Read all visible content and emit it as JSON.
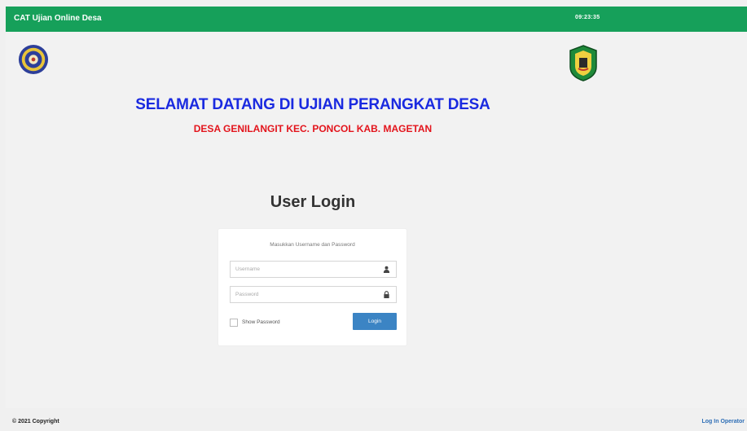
{
  "header": {
    "app_title": "CAT Ujian Online Desa",
    "clock": "09:23:35"
  },
  "welcome": {
    "title": "SELAMAT DATANG DI UJIAN PERANGKAT DESA",
    "subtitle": "DESA GENILANGIT KEC. PONCOL KAB. MAGETAN"
  },
  "login": {
    "title": "User Login",
    "hint": "Masukkan Username dan Password",
    "username_placeholder": "Username",
    "password_placeholder": "Password",
    "show_password_label": "Show Password",
    "button_label": "Login"
  },
  "footer": {
    "copyright": "© 2021 Copyright",
    "operator_link": "Log In Operator"
  },
  "icons": {
    "user": "user-icon",
    "lock": "lock-icon"
  },
  "colors": {
    "topbar": "#16a05a",
    "title_blue": "#1a2ae0",
    "subtitle_red": "#e3141c",
    "button": "#3b84c4"
  }
}
